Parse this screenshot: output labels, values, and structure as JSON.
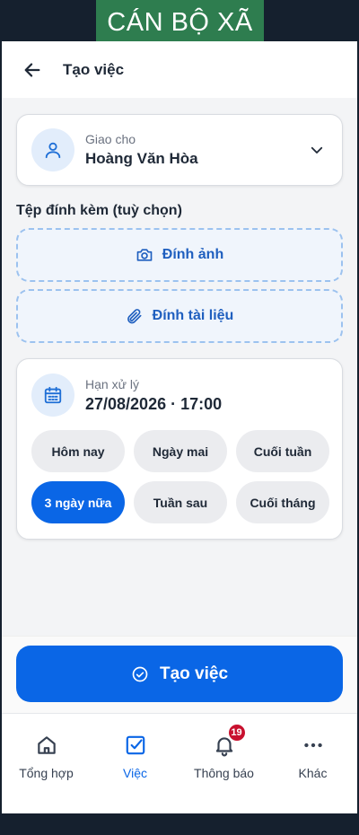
{
  "banner": {
    "text": "CÁN BỘ XÃ",
    "bg": "#2e7d4f"
  },
  "header": {
    "title": "Tạo việc",
    "back_icon": "arrow-left-icon"
  },
  "assign": {
    "label": "Giao cho",
    "name": "Hoàng Văn Hòa",
    "icon": "user-icon"
  },
  "attachments": {
    "label": "Tệp đính kèm (tuỳ chọn)",
    "photo_label": "Đính ảnh",
    "doc_label": "Đính tài liệu"
  },
  "deadline": {
    "label": "Hạn xử lý",
    "value": "27/08/2026 · 17:00",
    "chips": [
      {
        "label": "Hôm nay",
        "active": false
      },
      {
        "label": "Ngày mai",
        "active": false
      },
      {
        "label": "Cuối tuần",
        "active": false
      },
      {
        "label": "3 ngày nữa",
        "active": true
      },
      {
        "label": "Tuần sau",
        "active": false
      },
      {
        "label": "Cuối tháng",
        "active": false
      }
    ]
  },
  "submit": {
    "label": "Tạo việc"
  },
  "nav": {
    "items": [
      {
        "label": "Tổng hợp",
        "icon": "home-icon",
        "active": false
      },
      {
        "label": "Việc",
        "icon": "checkbox-icon",
        "active": true
      },
      {
        "label": "Thông báo",
        "icon": "bell-icon",
        "active": false,
        "badge": "19"
      },
      {
        "label": "Khác",
        "icon": "more-icon",
        "active": false
      }
    ]
  },
  "colors": {
    "accent": "#0a66e6",
    "badge": "#c8102e",
    "banner": "#2e7d4f"
  }
}
